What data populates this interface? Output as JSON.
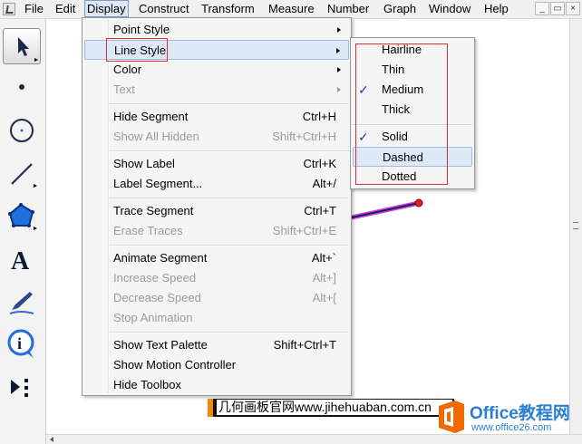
{
  "menubar": {
    "items": [
      {
        "label": "File"
      },
      {
        "label": "Edit"
      },
      {
        "label": "Display"
      },
      {
        "label": "Construct"
      },
      {
        "label": "Transform"
      },
      {
        "label": "Measure"
      },
      {
        "label": "Number"
      },
      {
        "label": "Graph"
      },
      {
        "label": "Window"
      },
      {
        "label": "Help"
      }
    ],
    "window_buttons": {
      "minimize": "_",
      "restore": "▭",
      "close": "×"
    }
  },
  "toolbox": {
    "tools": [
      {
        "name": "arrow-tool",
        "selected": true
      },
      {
        "name": "point-tool"
      },
      {
        "name": "compass-tool"
      },
      {
        "name": "straightedge-tool"
      },
      {
        "name": "polygon-tool"
      },
      {
        "name": "text-tool",
        "glyph": "A"
      },
      {
        "name": "marker-tool"
      },
      {
        "name": "information-tool",
        "glyph": "i"
      },
      {
        "name": "custom-tool"
      }
    ]
  },
  "display_menu": {
    "groups": [
      [
        {
          "label": "Point Style",
          "submenu": true
        },
        {
          "label": "Line Style",
          "submenu": true,
          "highlighted": true
        },
        {
          "label": "Color",
          "submenu": true
        },
        {
          "label": "Text",
          "submenu": true,
          "disabled": true
        }
      ],
      [
        {
          "label": "Hide Segment",
          "shortcut": "Ctrl+H"
        },
        {
          "label": "Show All Hidden",
          "shortcut": "Shift+Ctrl+H",
          "disabled": true
        }
      ],
      [
        {
          "label": "Show Label",
          "shortcut": "Ctrl+K"
        },
        {
          "label": "Label Segment...",
          "shortcut": "Alt+/"
        }
      ],
      [
        {
          "label": "Trace Segment",
          "shortcut": "Ctrl+T"
        },
        {
          "label": "Erase Traces",
          "shortcut": "Shift+Ctrl+E",
          "disabled": true
        }
      ],
      [
        {
          "label": "Animate Segment",
          "shortcut": "Alt+`"
        },
        {
          "label": "Increase Speed",
          "shortcut": "Alt+]",
          "disabled": true
        },
        {
          "label": "Decrease Speed",
          "shortcut": "Alt+[",
          "disabled": true
        },
        {
          "label": "Stop Animation",
          "disabled": true
        }
      ],
      [
        {
          "label": "Show Text Palette",
          "shortcut": "Shift+Ctrl+T"
        },
        {
          "label": "Show Motion Controller"
        },
        {
          "label": "Hide Toolbox"
        }
      ]
    ]
  },
  "line_style_submenu": {
    "groups": [
      [
        {
          "label": "Hairline"
        },
        {
          "label": "Thin"
        },
        {
          "label": "Medium",
          "checked": true
        },
        {
          "label": "Thick"
        }
      ],
      [
        {
          "label": "Solid",
          "checked": true
        },
        {
          "label": "Dashed",
          "highlighted": true
        },
        {
          "label": "Dotted"
        }
      ]
    ],
    "check_glyph": "✓"
  },
  "colors": {
    "accent_red": "#e03030",
    "segment": "#1a1a7a",
    "segment_halo": "#cc44cc",
    "point": "#e02020",
    "menu_highlight": "#dde9f7",
    "brand_orange": "#f06a00",
    "brand_blue": "#2a7fd4"
  },
  "watermarks": {
    "site_banner": "几何画板官网www.jihehuaban.com.cn",
    "brand_name": "Office教程网",
    "brand_url": "www.office26.com"
  }
}
